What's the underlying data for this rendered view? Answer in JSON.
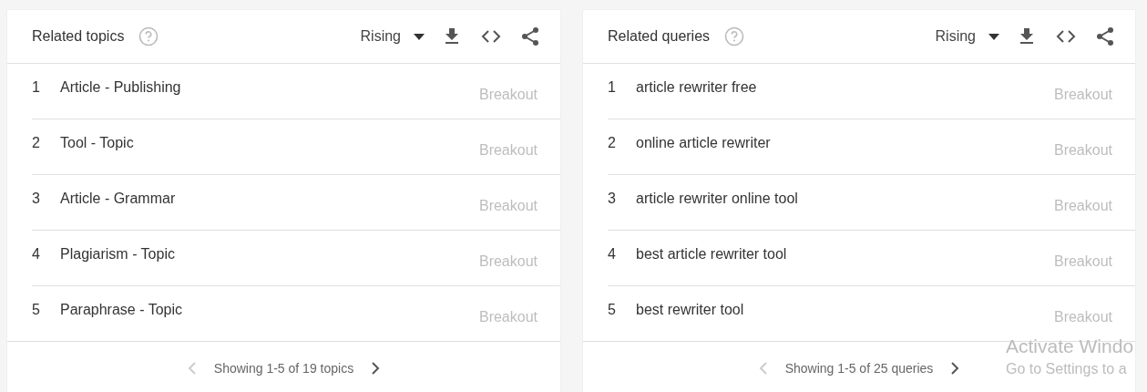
{
  "panels": [
    {
      "title": "Related topics",
      "sort": "Rising",
      "rows": [
        {
          "rank": "1",
          "label": "Article - Publishing",
          "value": "Breakout"
        },
        {
          "rank": "2",
          "label": "Tool - Topic",
          "value": "Breakout"
        },
        {
          "rank": "3",
          "label": "Article - Grammar",
          "value": "Breakout"
        },
        {
          "rank": "4",
          "label": "Plagiarism - Topic",
          "value": "Breakout"
        },
        {
          "rank": "5",
          "label": "Paraphrase - Topic",
          "value": "Breakout"
        }
      ],
      "pager": {
        "text": "Showing 1-5 of 19 topics",
        "prev_disabled": true,
        "next_disabled": false
      }
    },
    {
      "title": "Related queries",
      "sort": "Rising",
      "rows": [
        {
          "rank": "1",
          "label": "article rewriter free",
          "value": "Breakout"
        },
        {
          "rank": "2",
          "label": "online article rewriter",
          "value": "Breakout"
        },
        {
          "rank": "3",
          "label": "article rewriter online tool",
          "value": "Breakout"
        },
        {
          "rank": "4",
          "label": "best article rewriter tool",
          "value": "Breakout"
        },
        {
          "rank": "5",
          "label": "best rewriter tool",
          "value": "Breakout"
        }
      ],
      "pager": {
        "text": "Showing 1-5 of 25 queries",
        "prev_disabled": true,
        "next_disabled": false
      }
    }
  ],
  "activation_notice": {
    "title": "Activate Windo",
    "subtitle": "Go to Settings to a"
  }
}
